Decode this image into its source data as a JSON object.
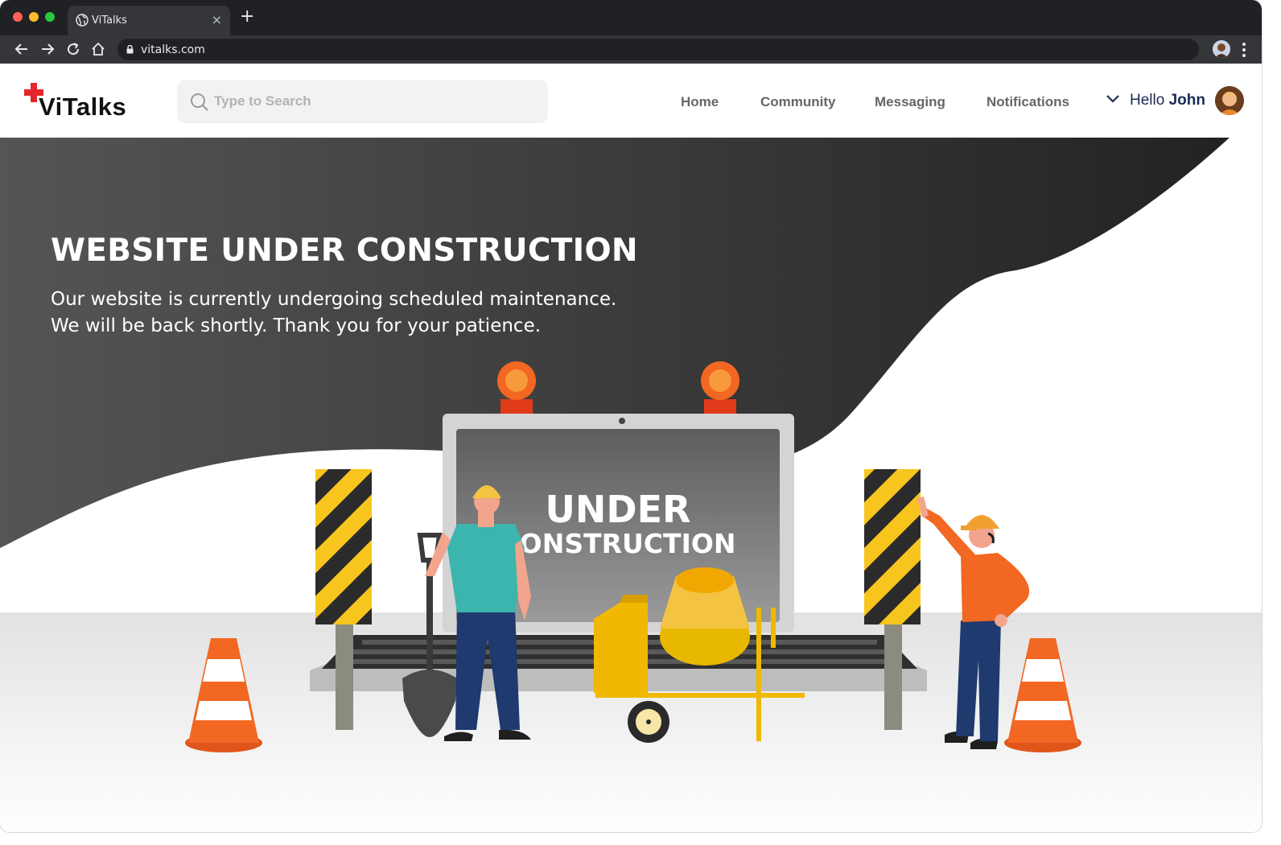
{
  "browser": {
    "tab_title": "ViTalks",
    "tab_close": "×",
    "new_tab": "+",
    "url": "vitalks.com"
  },
  "header": {
    "logo_text": "ViTalks",
    "search_placeholder": "Type to Search",
    "nav": [
      "Home",
      "Community",
      "Messaging",
      "Notifications"
    ],
    "greeting": "Hello",
    "user_name": "John"
  },
  "hero": {
    "title": "WEBSITE UNDER CONSTRUCTION",
    "line1": "Our website is currently undergoing scheduled maintenance.",
    "line2": "We will be back shortly. Thank you for your patience.",
    "screen_line1": "UNDER",
    "screen_line2": "CONSTRUCTION"
  },
  "colors": {
    "brand_red": "#e4262b",
    "hero_dark": "#3b3b3b",
    "stripe_yellow": "#f7c51e",
    "cone_orange": "#f26722",
    "username_navy": "#1b2a56"
  },
  "icons": [
    "globe-icon",
    "close-icon",
    "plus-icon",
    "back-arrow-icon",
    "forward-arrow-icon",
    "reload-icon",
    "home-icon",
    "lock-icon",
    "profile-icon",
    "kebab-menu-icon",
    "search-icon",
    "chevron-down-icon",
    "avatar"
  ]
}
